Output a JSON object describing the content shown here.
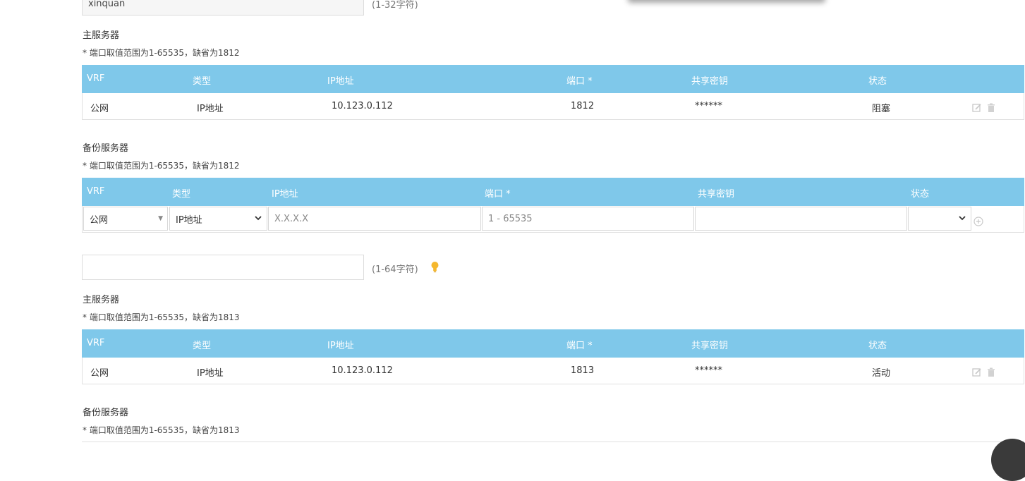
{
  "top": {
    "name_value": "xinquan",
    "name_hint": "(1-32字符)"
  },
  "columns_full": [
    "VRF",
    "类型",
    "IP地址",
    "端口 *",
    "共享密钥",
    "状态"
  ],
  "section1": {
    "primary_title": "主服务器",
    "primary_note": "* 端口取值范围为1-65535，缺省为1812",
    "primary_row": {
      "vrf": "公网",
      "type": "IP地址",
      "ip": "10.123.0.112",
      "port": "1812",
      "key": "******",
      "status": "阻塞"
    },
    "backup_title": "备份服务器",
    "backup_note": "* 端口取值范围为1-65535，缺省为1812",
    "backup_form": {
      "vrf_value": "公网",
      "type_value": "IP地址",
      "ip_placeholder": "X.X.X.X",
      "port_placeholder": "1 - 65535",
      "key_value": "",
      "status_value": ""
    }
  },
  "section2": {
    "key_value": "",
    "key_hint": "(1-64字符)",
    "primary_title": "主服务器",
    "primary_note": "* 端口取值范围为1-65535，缺省为1813",
    "primary_row": {
      "vrf": "公网",
      "type": "IP地址",
      "ip": "10.123.0.112",
      "port": "1813",
      "key": "******",
      "status": "活动"
    },
    "backup_title": "备份服务器",
    "backup_note": "* 端口取值范围为1-65535，缺省为1813"
  },
  "colors": {
    "header_bg": "#7fc8ea",
    "bulb": "#f5b82e"
  },
  "icons": [
    "edit-icon",
    "delete-icon",
    "add-circle-icon",
    "bulb-icon",
    "chevron-down-icon"
  ]
}
